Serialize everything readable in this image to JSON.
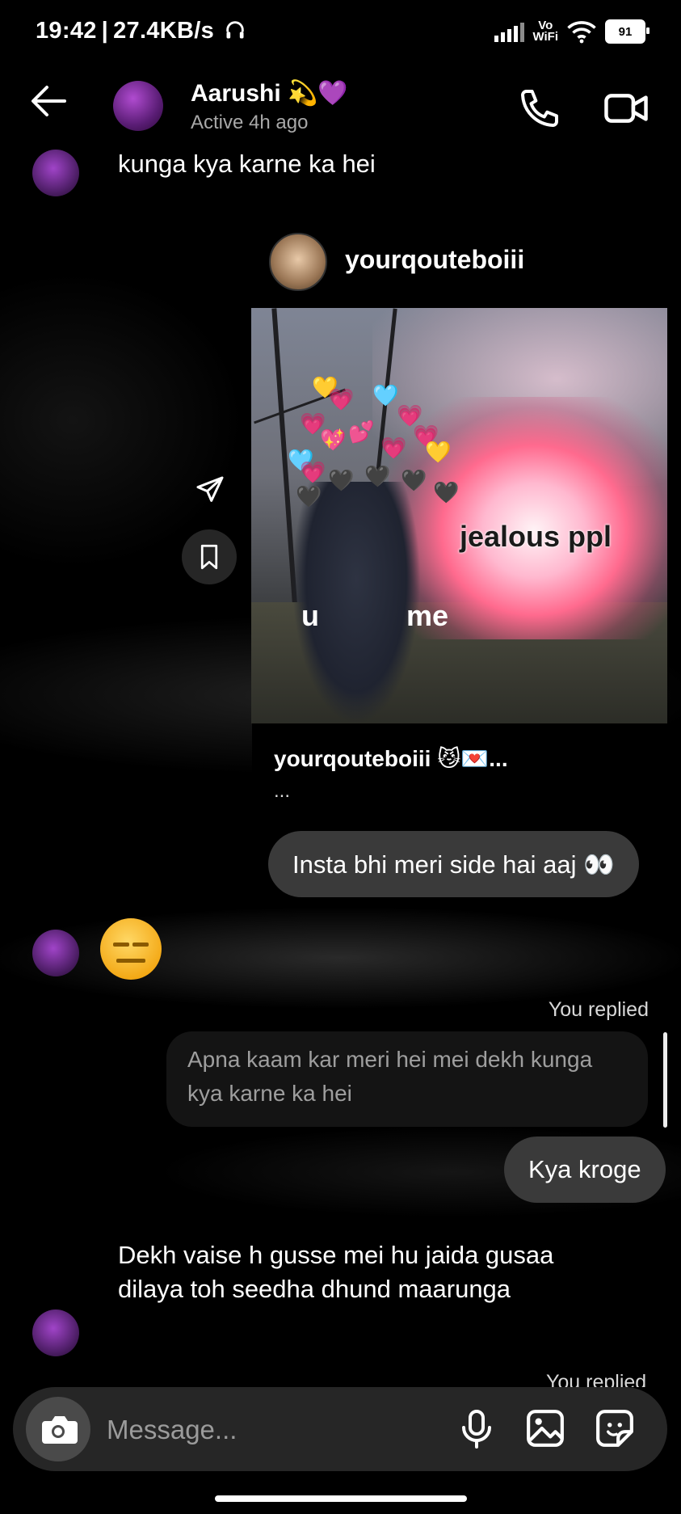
{
  "status_bar": {
    "time": "19:42",
    "network_speed": "27.4KB/s",
    "vowifi_top": "Vo",
    "vowifi_bottom": "WiFi",
    "battery": "91"
  },
  "header": {
    "name": "Aarushi 💫💜",
    "status": "Active 4h ago"
  },
  "messages": {
    "received_1": "kunga kya karne ka hei",
    "shared_post": {
      "username": "yourqouteboiii",
      "image_text_jealous": "jealous ppl",
      "image_text_u": "u",
      "image_text_me": "me",
      "caption": "yourqouteboiii 😼💌...",
      "more": "..."
    },
    "sent_1": "Insta bhi meri side hai aaj 👀",
    "received_emoji": "😑",
    "replied_label": "You replied",
    "quoted_text": "Apna kaam kar meri hei mei dekh kunga kya karne ka hei",
    "sent_2": "Kya kroge",
    "received_2": "Dekh vaise h gusse mei hu jaida gusaa dilaya toh seedha dhund maarunga",
    "replied_label_partial": "You replied"
  },
  "composer": {
    "placeholder": "Message..."
  }
}
